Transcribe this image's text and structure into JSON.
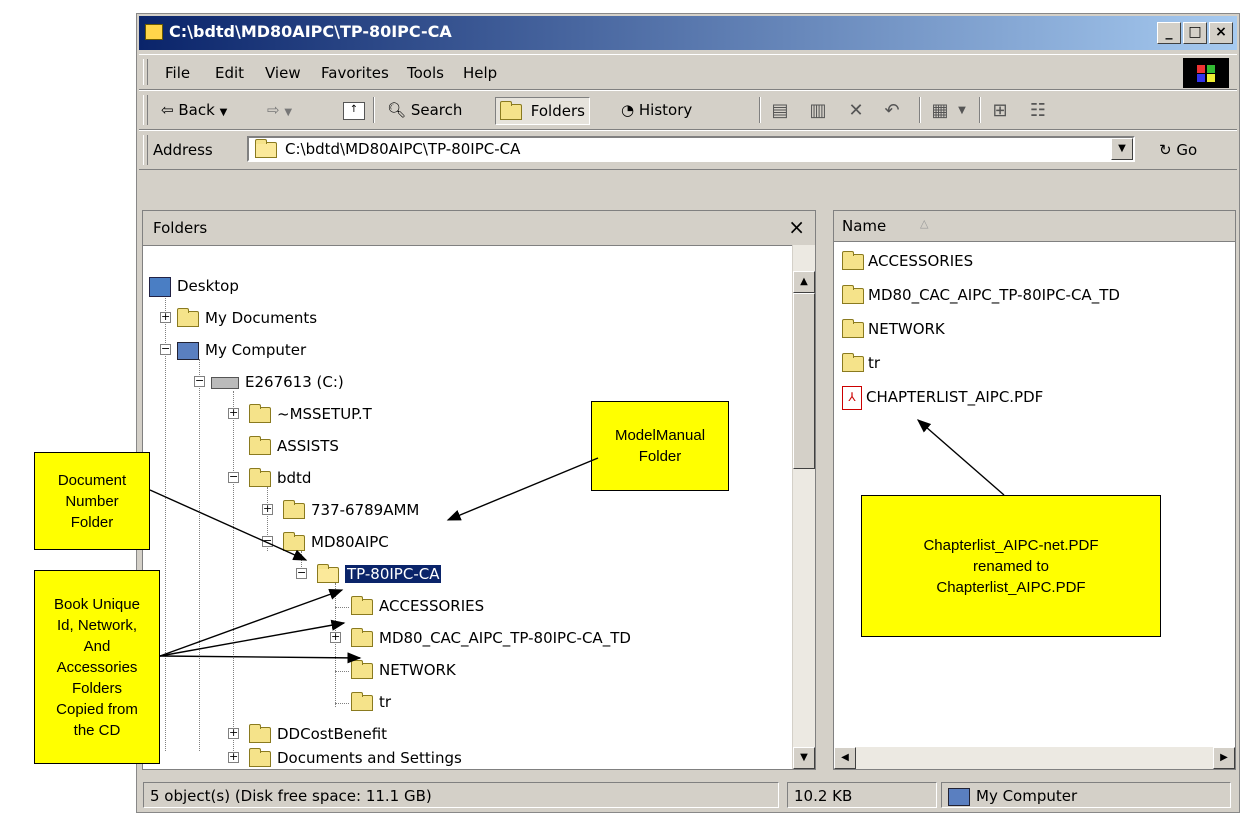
{
  "window": {
    "title": "C:\\bdtd\\MD80AIPC\\TP-80IPC-CA",
    "controls": {
      "minimize": "_",
      "maximize": "□",
      "close": "×"
    }
  },
  "menu": [
    "File",
    "Edit",
    "View",
    "Favorites",
    "Tools",
    "Help"
  ],
  "toolbar": {
    "back": "Back",
    "search": "Search",
    "folders": "Folders",
    "history": "History"
  },
  "address": {
    "label": "Address",
    "value": "C:\\bdtd\\MD80AIPC\\TP-80IPC-CA",
    "go": "Go"
  },
  "folders_pane": {
    "title": "Folders",
    "close": "×",
    "tree": [
      {
        "label": "Desktop"
      },
      {
        "label": "My Documents"
      },
      {
        "label": "My Computer"
      },
      {
        "label": "E267613 (C:)"
      },
      {
        "label": "~MSSETUP.T"
      },
      {
        "label": "ASSISTS"
      },
      {
        "label": "bdtd"
      },
      {
        "label": "737-6789AMM"
      },
      {
        "label": "MD80AIPC"
      },
      {
        "label": "TP-80IPC-CA"
      },
      {
        "label": "ACCESSORIES"
      },
      {
        "label": "MD80_CAC_AIPC_TP-80IPC-CA_TD"
      },
      {
        "label": "NETWORK"
      },
      {
        "label": "tr"
      },
      {
        "label": "DDCostBenefit"
      },
      {
        "label": "Documents and Settings"
      }
    ]
  },
  "file_list": {
    "column": "Name",
    "items": [
      {
        "name": "ACCESSORIES",
        "icon": "folder-icon"
      },
      {
        "name": "MD80_CAC_AIPC_TP-80IPC-CA_TD",
        "icon": "folder-icon"
      },
      {
        "name": "NETWORK",
        "icon": "folder-icon"
      },
      {
        "name": "tr",
        "icon": "folder-icon"
      },
      {
        "name": "CHAPTERLIST_AIPC.PDF",
        "icon": "pdf-icon"
      }
    ]
  },
  "status": {
    "objects": "5 object(s) (Disk free space: 11.1 GB)",
    "size": "10.2 KB",
    "zone": "My Computer"
  },
  "annotations": {
    "model_manual": [
      "ModelManual",
      "Folder"
    ],
    "document_number": [
      "Document",
      "Number",
      "Folder"
    ],
    "book_unique": [
      "Book Unique",
      "Id, Network,",
      "And",
      "Accessories",
      "Folders",
      "Copied from",
      "the CD"
    ],
    "chapterlist": [
      "Chapterlist_AIPC-net.PDF",
      "renamed to",
      "Chapterlist_AIPC.PDF"
    ]
  },
  "colors": {
    "note_bg": "#ffff00",
    "title_start": "#0a246a",
    "title_end": "#a6caf0",
    "selection": "#0a246a"
  }
}
